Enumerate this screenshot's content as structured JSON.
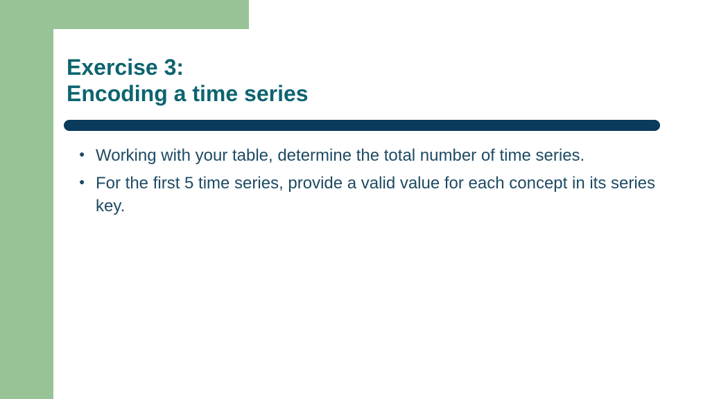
{
  "title": {
    "line1": "Exercise 3:",
    "line2": "Encoding a time series"
  },
  "bullets": [
    "Working with your table, determine the total number of time series.",
    "For the first 5 time series, provide a valid value for each concept in its series key."
  ]
}
